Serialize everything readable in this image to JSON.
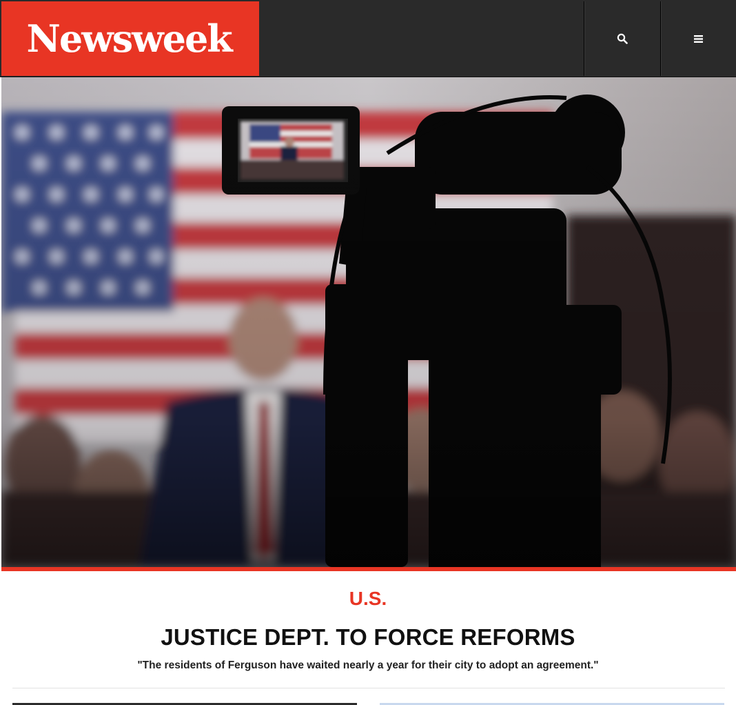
{
  "header": {
    "logo_text": "Newsweek",
    "logo_mark": ".",
    "search_icon": "search-icon",
    "menu_icon": "hamburger-menu-icon"
  },
  "hero": {
    "image_subject": "television camera filming a speaker in front of an American flag"
  },
  "article": {
    "section": "U.S.",
    "headline": "JUSTICE DEPT. TO FORCE REFORMS",
    "dek": "\"The residents of Ferguson have waited nearly a year for their city to adopt an agreement.\""
  },
  "colors": {
    "brand_red": "#e83524",
    "header_bg": "#2a2a2a"
  }
}
